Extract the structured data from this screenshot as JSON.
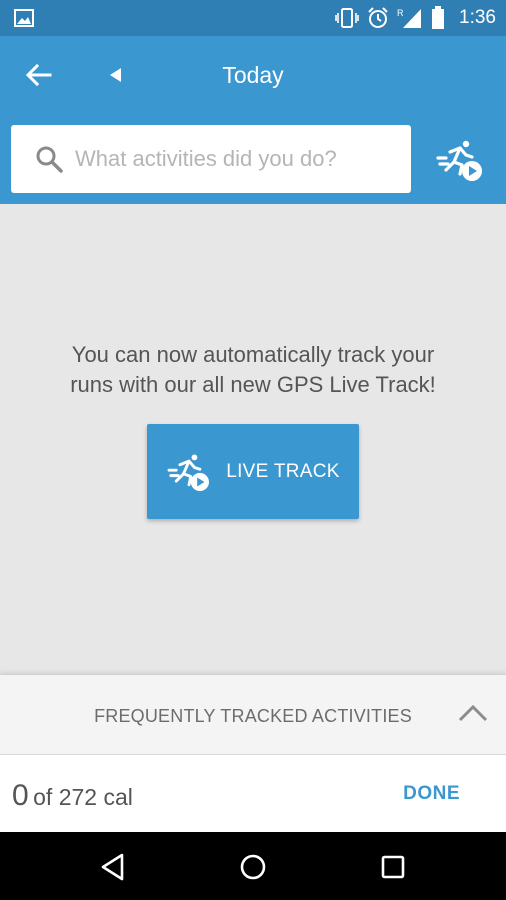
{
  "status_bar": {
    "time": "1:36",
    "icons": [
      "image-icon",
      "vibrate-icon",
      "alarm-icon",
      "signal-roaming-icon",
      "battery-icon"
    ]
  },
  "app_bar": {
    "title": "Today",
    "icons": [
      "back-arrow-icon",
      "previous-day-icon"
    ]
  },
  "search": {
    "placeholder": "What activities did you do?",
    "icon": "search-icon",
    "live_track_icon": "runner-play-icon"
  },
  "promo": {
    "text_line1": "You can now automatically track your",
    "text_line2": "runs with our all new GPS Live Track!",
    "button_label": "LIVE TRACK"
  },
  "frequent": {
    "label": "FREQUENTLY TRACKED ACTIVITIES",
    "icon": "chevron-up-icon"
  },
  "calories": {
    "current": "0",
    "of_total": "of 272 cal",
    "done_label": "DONE"
  },
  "nav_bar": {
    "icons": [
      "back-triangle-icon",
      "home-circle-icon",
      "recents-square-icon"
    ]
  },
  "colors": {
    "status_bar": "#2f7fb5",
    "accent": "#3b97cf",
    "background": "#e7e7e7"
  }
}
